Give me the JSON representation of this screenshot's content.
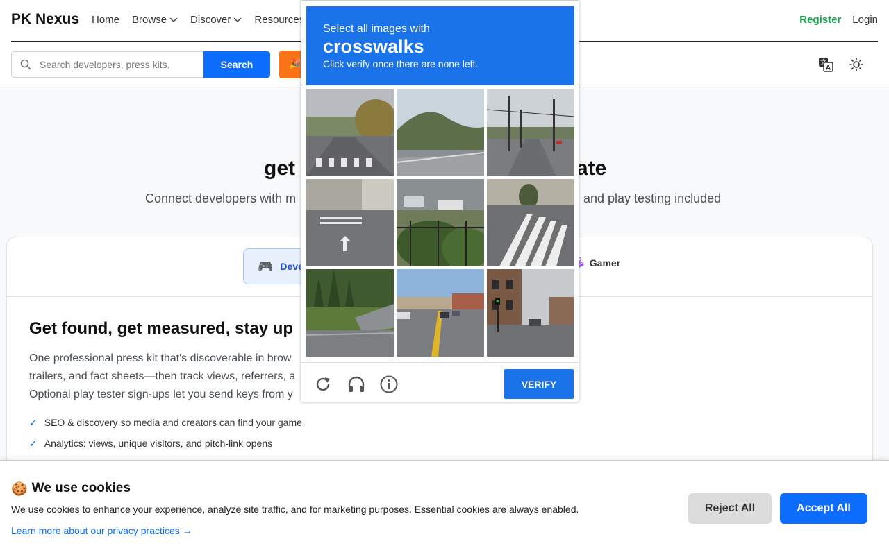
{
  "header": {
    "brand": "PK Nexus",
    "nav": [
      {
        "label": "Home",
        "dropdown": false
      },
      {
        "label": "Browse",
        "dropdown": true
      },
      {
        "label": "Discover",
        "dropdown": true
      },
      {
        "label": "Resources",
        "dropdown": false
      }
    ],
    "register": "Register",
    "login": "Login",
    "search_placeholder": "Search developers, press kits.",
    "search_button": "Search",
    "promo_icon": "🎉",
    "translate_icon": "translate-icon",
    "theme_icon": "sun-icon"
  },
  "hero": {
    "title_left": "get",
    "title_right": "ate",
    "subtitle_left": "Connect developers with m",
    "subtitle_right": ", and play testing included"
  },
  "card": {
    "tab_developer": "Deve",
    "tab_developer_icon": "🎮",
    "tab_gamer": "Gamer",
    "tab_gamer_icon": "🕹",
    "title": "Get found, get measured, stay up",
    "body_lines": [
      "One professional press kit that's discoverable in brow",
      "trailers, and fact sheets—then track views, referrers, a",
      "Optional play tester sign-ups let you send keys from y"
    ],
    "features": [
      "SEO & discovery so media and creators can find your game",
      "Analytics: views, unique visitors, and pitch-link opens"
    ]
  },
  "captcha": {
    "line1": "Select all images with",
    "target": "crosswalks",
    "line3": "Click verify once there are none left.",
    "verify": "VERIFY",
    "tiles": [
      "road-crosswalk-trees",
      "highway-mountain",
      "road-tram-poles",
      "road-arrow-marking",
      "parking-fence-bushes",
      "crosswalk-stripes-closeup",
      "highway-bridge-trees",
      "road-cars-yellow-line",
      "street-brick-houses"
    ]
  },
  "cookie": {
    "icon": "🍪",
    "title": "We use cookies",
    "text": "We use cookies to enhance your experience, analyze site traffic, and for marketing purposes. Essential cookies are always enabled.",
    "link": "Learn more about our privacy practices →",
    "reject": "Reject All",
    "accept": "Accept All"
  }
}
